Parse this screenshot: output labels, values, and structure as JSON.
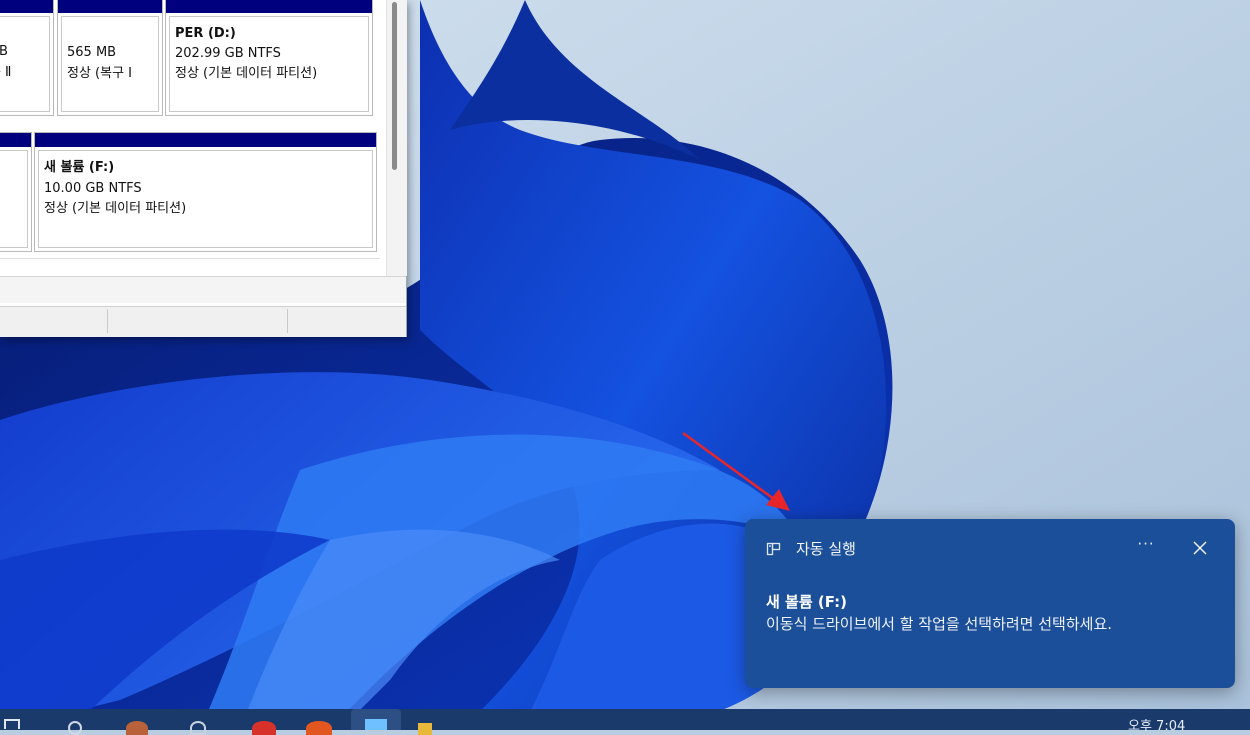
{
  "disk_management": {
    "top_row": [
      {
        "size": "B",
        "status": "복구 Ⅱ"
      },
      {
        "size": "565 MB",
        "status": "정상 (복구 I"
      },
      {
        "name": "PER  (D:)",
        "size": "202.99 GB NTFS",
        "status": "정상 (기본 데이터 파티션)"
      }
    ],
    "bottom_row": [
      {
        "name": "새 볼륨  (F:)",
        "size": "10.00 GB NTFS",
        "status": "정상 (기본 데이터 파티션)"
      }
    ]
  },
  "toast": {
    "app_name": "자동 실행",
    "icon": "autoplay-icon",
    "more_label": "···",
    "title": "새 볼륨 (F:)",
    "body": "이동식 드라이브에서 할 작업을 선택하려면 선택하세요.",
    "background": "#1b4f99"
  },
  "annotation": {
    "arrow_color": "#e8262a"
  },
  "taskbar": {
    "clock_text": "오후 7:04"
  }
}
